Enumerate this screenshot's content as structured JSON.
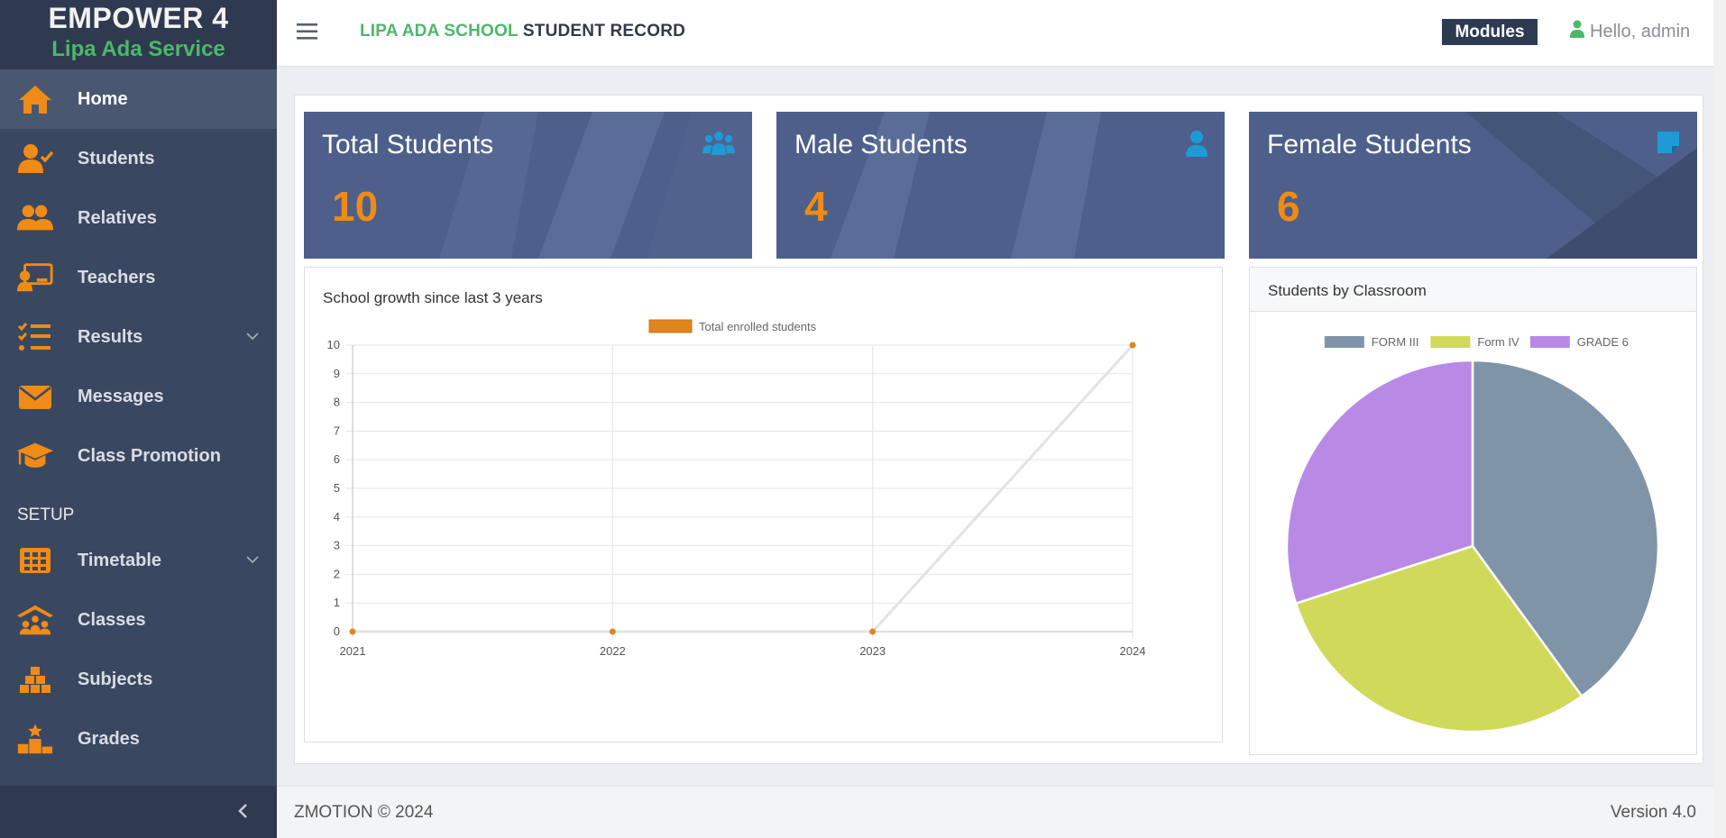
{
  "brand": {
    "title": "EMPOWER 4",
    "subtitle": "Lipa Ada Service"
  },
  "sidebar": {
    "items": [
      {
        "label": "Home",
        "icon": "home-icon"
      },
      {
        "label": "Students",
        "icon": "user-check-icon"
      },
      {
        "label": "Relatives",
        "icon": "users-icon"
      },
      {
        "label": "Teachers",
        "icon": "chalkboard-teacher-icon"
      },
      {
        "label": "Results",
        "icon": "list-check-icon"
      },
      {
        "label": "Messages",
        "icon": "envelope-icon"
      },
      {
        "label": "Class Promotion",
        "icon": "graduation-cap-icon"
      }
    ],
    "section_label": "SETUP",
    "setup_items": [
      {
        "label": "Timetable",
        "icon": "calendar-grid-icon"
      },
      {
        "label": "Classes",
        "icon": "school-icon"
      },
      {
        "label": "Subjects",
        "icon": "cubes-icon"
      },
      {
        "label": "Grades",
        "icon": "podium-icon"
      }
    ]
  },
  "header": {
    "title_highlight": "LIPA ADA SCHOOL",
    "title_rest": "STUDENT RECORD",
    "modules_label": "Modules",
    "user_greeting": "Hello, admin"
  },
  "stats": {
    "total": {
      "title": "Total Students",
      "value": "10"
    },
    "male": {
      "title": "Male Students",
      "value": "4"
    },
    "female": {
      "title": "Female Students",
      "value": "6"
    }
  },
  "growth_card": {
    "title": "School growth since last 3 years"
  },
  "pie_card": {
    "title": "Students by Classroom"
  },
  "footer": {
    "copyright": "ZMOTION © 2024",
    "version": "Version 4.0"
  },
  "colors": {
    "sidebar_bg": "#3a4760",
    "accent_orange": "#ef8b16",
    "accent_green": "#4cb86b",
    "stat_bg": "#4d5f8a",
    "stat_icon": "#1e9bd7"
  },
  "chart_data": [
    {
      "type": "line",
      "x": [
        "2021",
        "2022",
        "2023",
        "2024"
      ],
      "series": [
        {
          "name": "Total enrolled students",
          "values": [
            0,
            0,
            0,
            10
          ],
          "color": "#e0861f"
        }
      ],
      "ylim": [
        0,
        10
      ],
      "yticks": [
        "0",
        "1",
        "2",
        "3",
        "4",
        "5",
        "6",
        "7",
        "8",
        "9",
        "10"
      ],
      "grid": true,
      "legend": "top-center"
    },
    {
      "type": "pie",
      "categories": [
        "FORM III",
        "Form IV",
        "GRADE 6"
      ],
      "values": [
        4,
        3,
        3
      ],
      "colors": [
        "#8094a8",
        "#d1d95a",
        "#b88ae6"
      ],
      "legend": "top-center"
    }
  ]
}
